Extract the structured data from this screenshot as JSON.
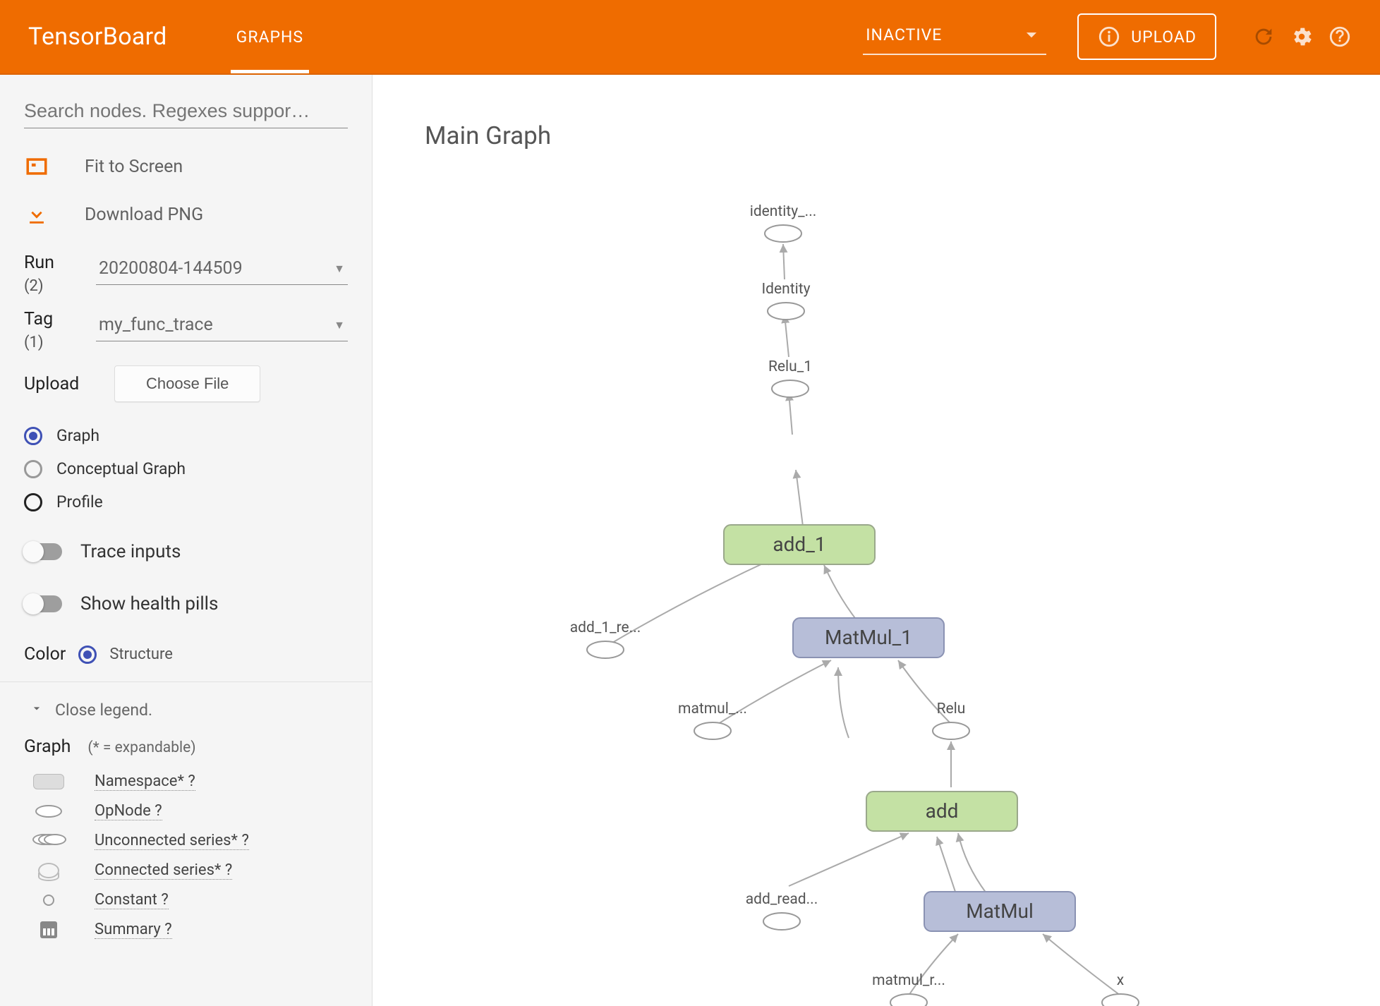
{
  "header": {
    "brand": "TensorBoard",
    "tab_graphs": "GRAPHS",
    "inactive": "INACTIVE",
    "upload": "UPLOAD"
  },
  "sidebar": {
    "search_placeholder": "Search nodes. Regexes suppor…",
    "fit_label": "Fit to Screen",
    "download_label": "Download PNG",
    "run_label": "Run",
    "run_count": "(2)",
    "run_value": "20200804-144509",
    "tag_label": "Tag",
    "tag_count": "(1)",
    "tag_value": "my_func_trace",
    "upload_label": "Upload",
    "choose_file": "Choose File",
    "radio_graph": "Graph",
    "radio_conceptual": "Conceptual Graph",
    "radio_profile": "Profile",
    "toggle_trace": "Trace inputs",
    "toggle_health": "Show health pills",
    "color_label": "Color",
    "color_structure": "Structure"
  },
  "legend": {
    "close": "Close legend.",
    "title": "Graph",
    "hint": "(* = expandable)",
    "namespace": "Namespace* ?",
    "opnode": "OpNode ?",
    "unconnected": "Unconnected series* ?",
    "connected": "Connected series* ?",
    "constant": "Constant ?",
    "summary": "Summary ?"
  },
  "graph": {
    "title": "Main Graph",
    "identity_ret": "identity_...",
    "identity": "Identity",
    "relu1": "Relu_1",
    "add1": "add_1",
    "add1_re": "add_1_re...",
    "matmul1": "MatMul_1",
    "matmul_sm": "matmul_...",
    "relu": "Relu",
    "add": "add",
    "add_read": "add_read...",
    "matmul": "MatMul",
    "matmul_r": "matmul_r...",
    "x": "x"
  }
}
